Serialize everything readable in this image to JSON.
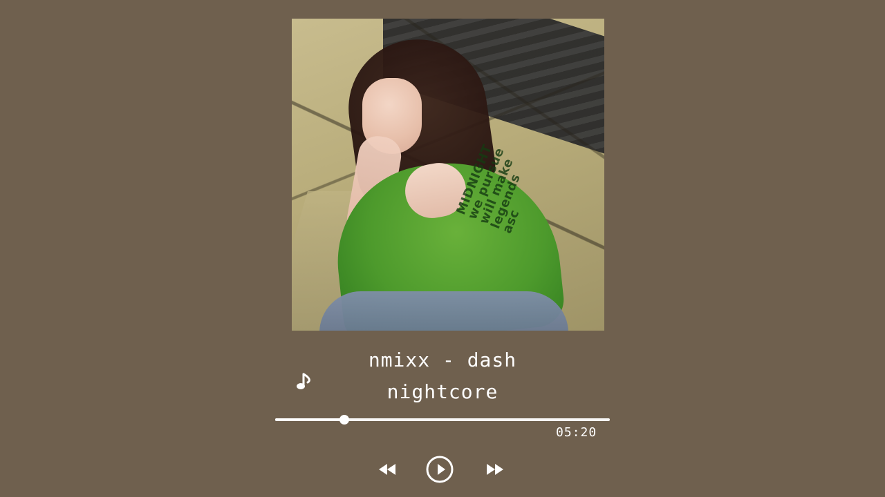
{
  "player": {
    "title": "nmixx - dash",
    "subtitle": "nightcore",
    "time_total": "05:20",
    "progress_fraction": 0.206,
    "icons": {
      "note": "music-note-icon",
      "prev": "rewind-icon",
      "play": "play-icon",
      "next": "fast-forward-icon"
    },
    "colors": {
      "background": "#6f604e",
      "foreground": "#ffffff"
    }
  },
  "cover": {
    "sweater_text": "MIDNIGHT\nwe pursue\nwill make\nlegends\nasc"
  }
}
